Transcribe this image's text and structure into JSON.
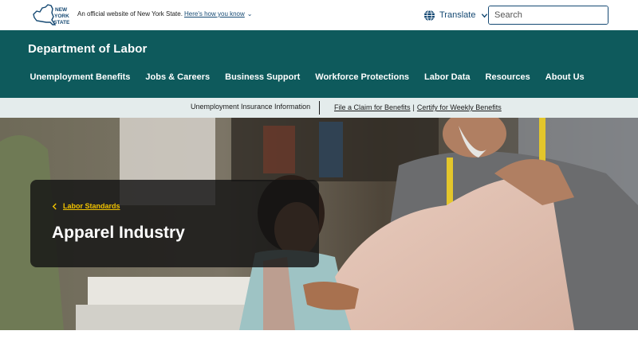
{
  "universal_header": {
    "logo_text": [
      "NEW",
      "YORK",
      "STATE"
    ],
    "official_text": "An official website of New York State.",
    "how_you_know": "Here's how you know",
    "translate_label": "Translate",
    "search_placeholder": "Search"
  },
  "agency": {
    "name": "Department of Labor",
    "nav": [
      {
        "label": "Unemployment Benefits"
      },
      {
        "label": "Jobs & Careers"
      },
      {
        "label": "Business Support"
      },
      {
        "label": "Workforce Protections"
      },
      {
        "label": "Labor Data"
      },
      {
        "label": "Resources"
      },
      {
        "label": "About Us"
      }
    ]
  },
  "sub_banner": {
    "info_label": "Unemployment Insurance Information",
    "link_file_claim": "File a Claim for Benefits",
    "separator": "|",
    "link_certify": "Certify for Weekly Benefits"
  },
  "hero": {
    "breadcrumb": "Labor Standards",
    "title": "Apparel Industry"
  },
  "colors": {
    "brand_teal": "#0e5a5c",
    "nys_blue": "#154973",
    "breadcrumb_gold": "#f2c300",
    "sub_banner_bg": "#e4ecec"
  }
}
